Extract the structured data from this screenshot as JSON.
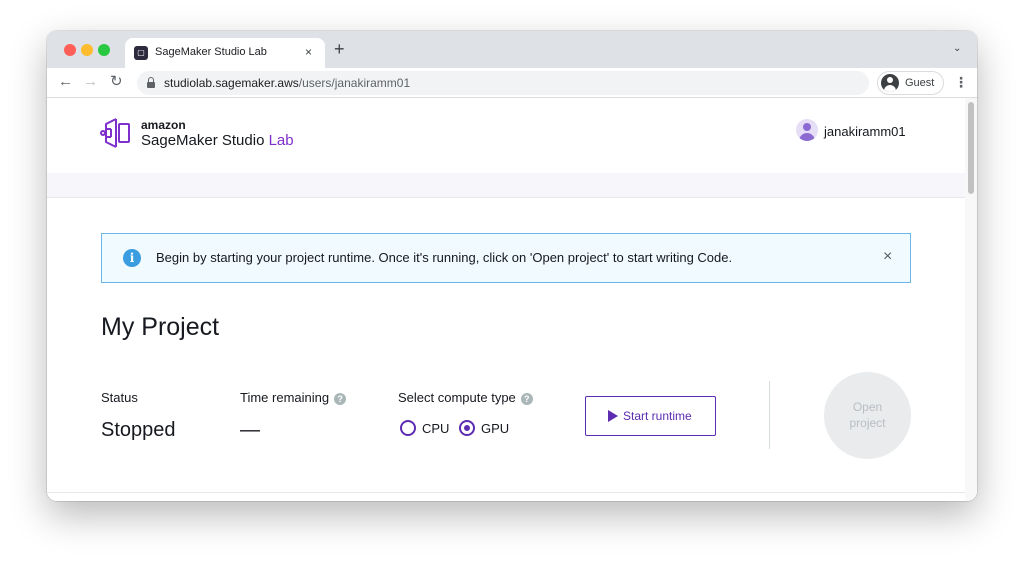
{
  "browser": {
    "tab": {
      "title": "SageMaker Studio Lab",
      "favicon_icon": "sagemaker-studio-lab-icon"
    },
    "url": {
      "host": "studiolab.sagemaker.aws",
      "path": "/users/janakiramm01"
    },
    "profile": {
      "label": "Guest"
    },
    "controls": {
      "tab_close": "×",
      "new_tab": "+",
      "tab_menu": "⌄",
      "kebab": "⋮",
      "back": "←",
      "forward": "→",
      "reload": "↻"
    },
    "traffic_colors": {
      "close": "#ff5f57",
      "minimize": "#febc2e",
      "maximize": "#28c840"
    }
  },
  "header": {
    "brand_amazon": "amazon",
    "brand_product": "SageMaker Studio",
    "brand_lab": "Lab",
    "accent_color": "#7f2fcc",
    "user": {
      "name": "janakiramm01"
    }
  },
  "alert": {
    "text": "Begin by starting your project runtime. Once it's running, click on 'Open project' to start writing Code.",
    "icon": "info-icon",
    "close": "×"
  },
  "project": {
    "title": "My Project",
    "status": {
      "label": "Status",
      "value": "Stopped"
    },
    "time_remaining": {
      "label": "Time remaining",
      "value": "—",
      "help": "?"
    },
    "compute": {
      "label": "Select compute type",
      "help": "?",
      "options": [
        {
          "label": "CPU",
          "selected": false
        },
        {
          "label": "GPU",
          "selected": true
        }
      ]
    },
    "start_button": {
      "label": "Start runtime",
      "icon": "play-icon"
    },
    "open_button": {
      "line1": "Open",
      "line2": "project",
      "enabled": false
    }
  }
}
